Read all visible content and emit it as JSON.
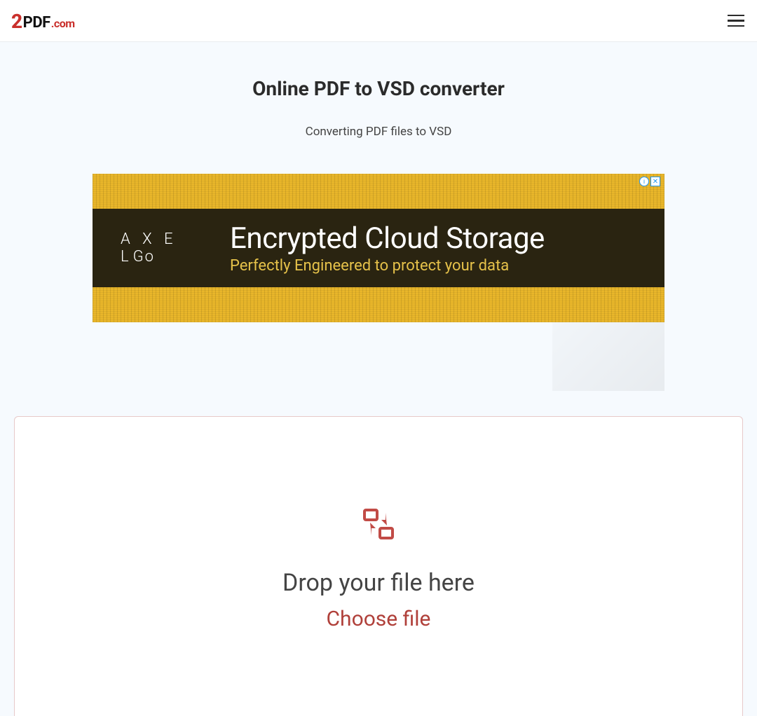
{
  "logo": {
    "two": "2",
    "pdf": "PDF",
    "dotcom": ".com"
  },
  "header": {
    "title": "Online PDF to VSD converter",
    "subtitle": "Converting PDF files to VSD"
  },
  "ad": {
    "brand": "A X E L",
    "brand_suffix": "Go",
    "headline": "Encrypted Cloud Storage",
    "tagline": "Perfectly Engineered to protect your data",
    "info_glyph": "i",
    "close_glyph": "✕"
  },
  "dropzone": {
    "title": "Drop your file here",
    "choose_label": "Choose file"
  }
}
